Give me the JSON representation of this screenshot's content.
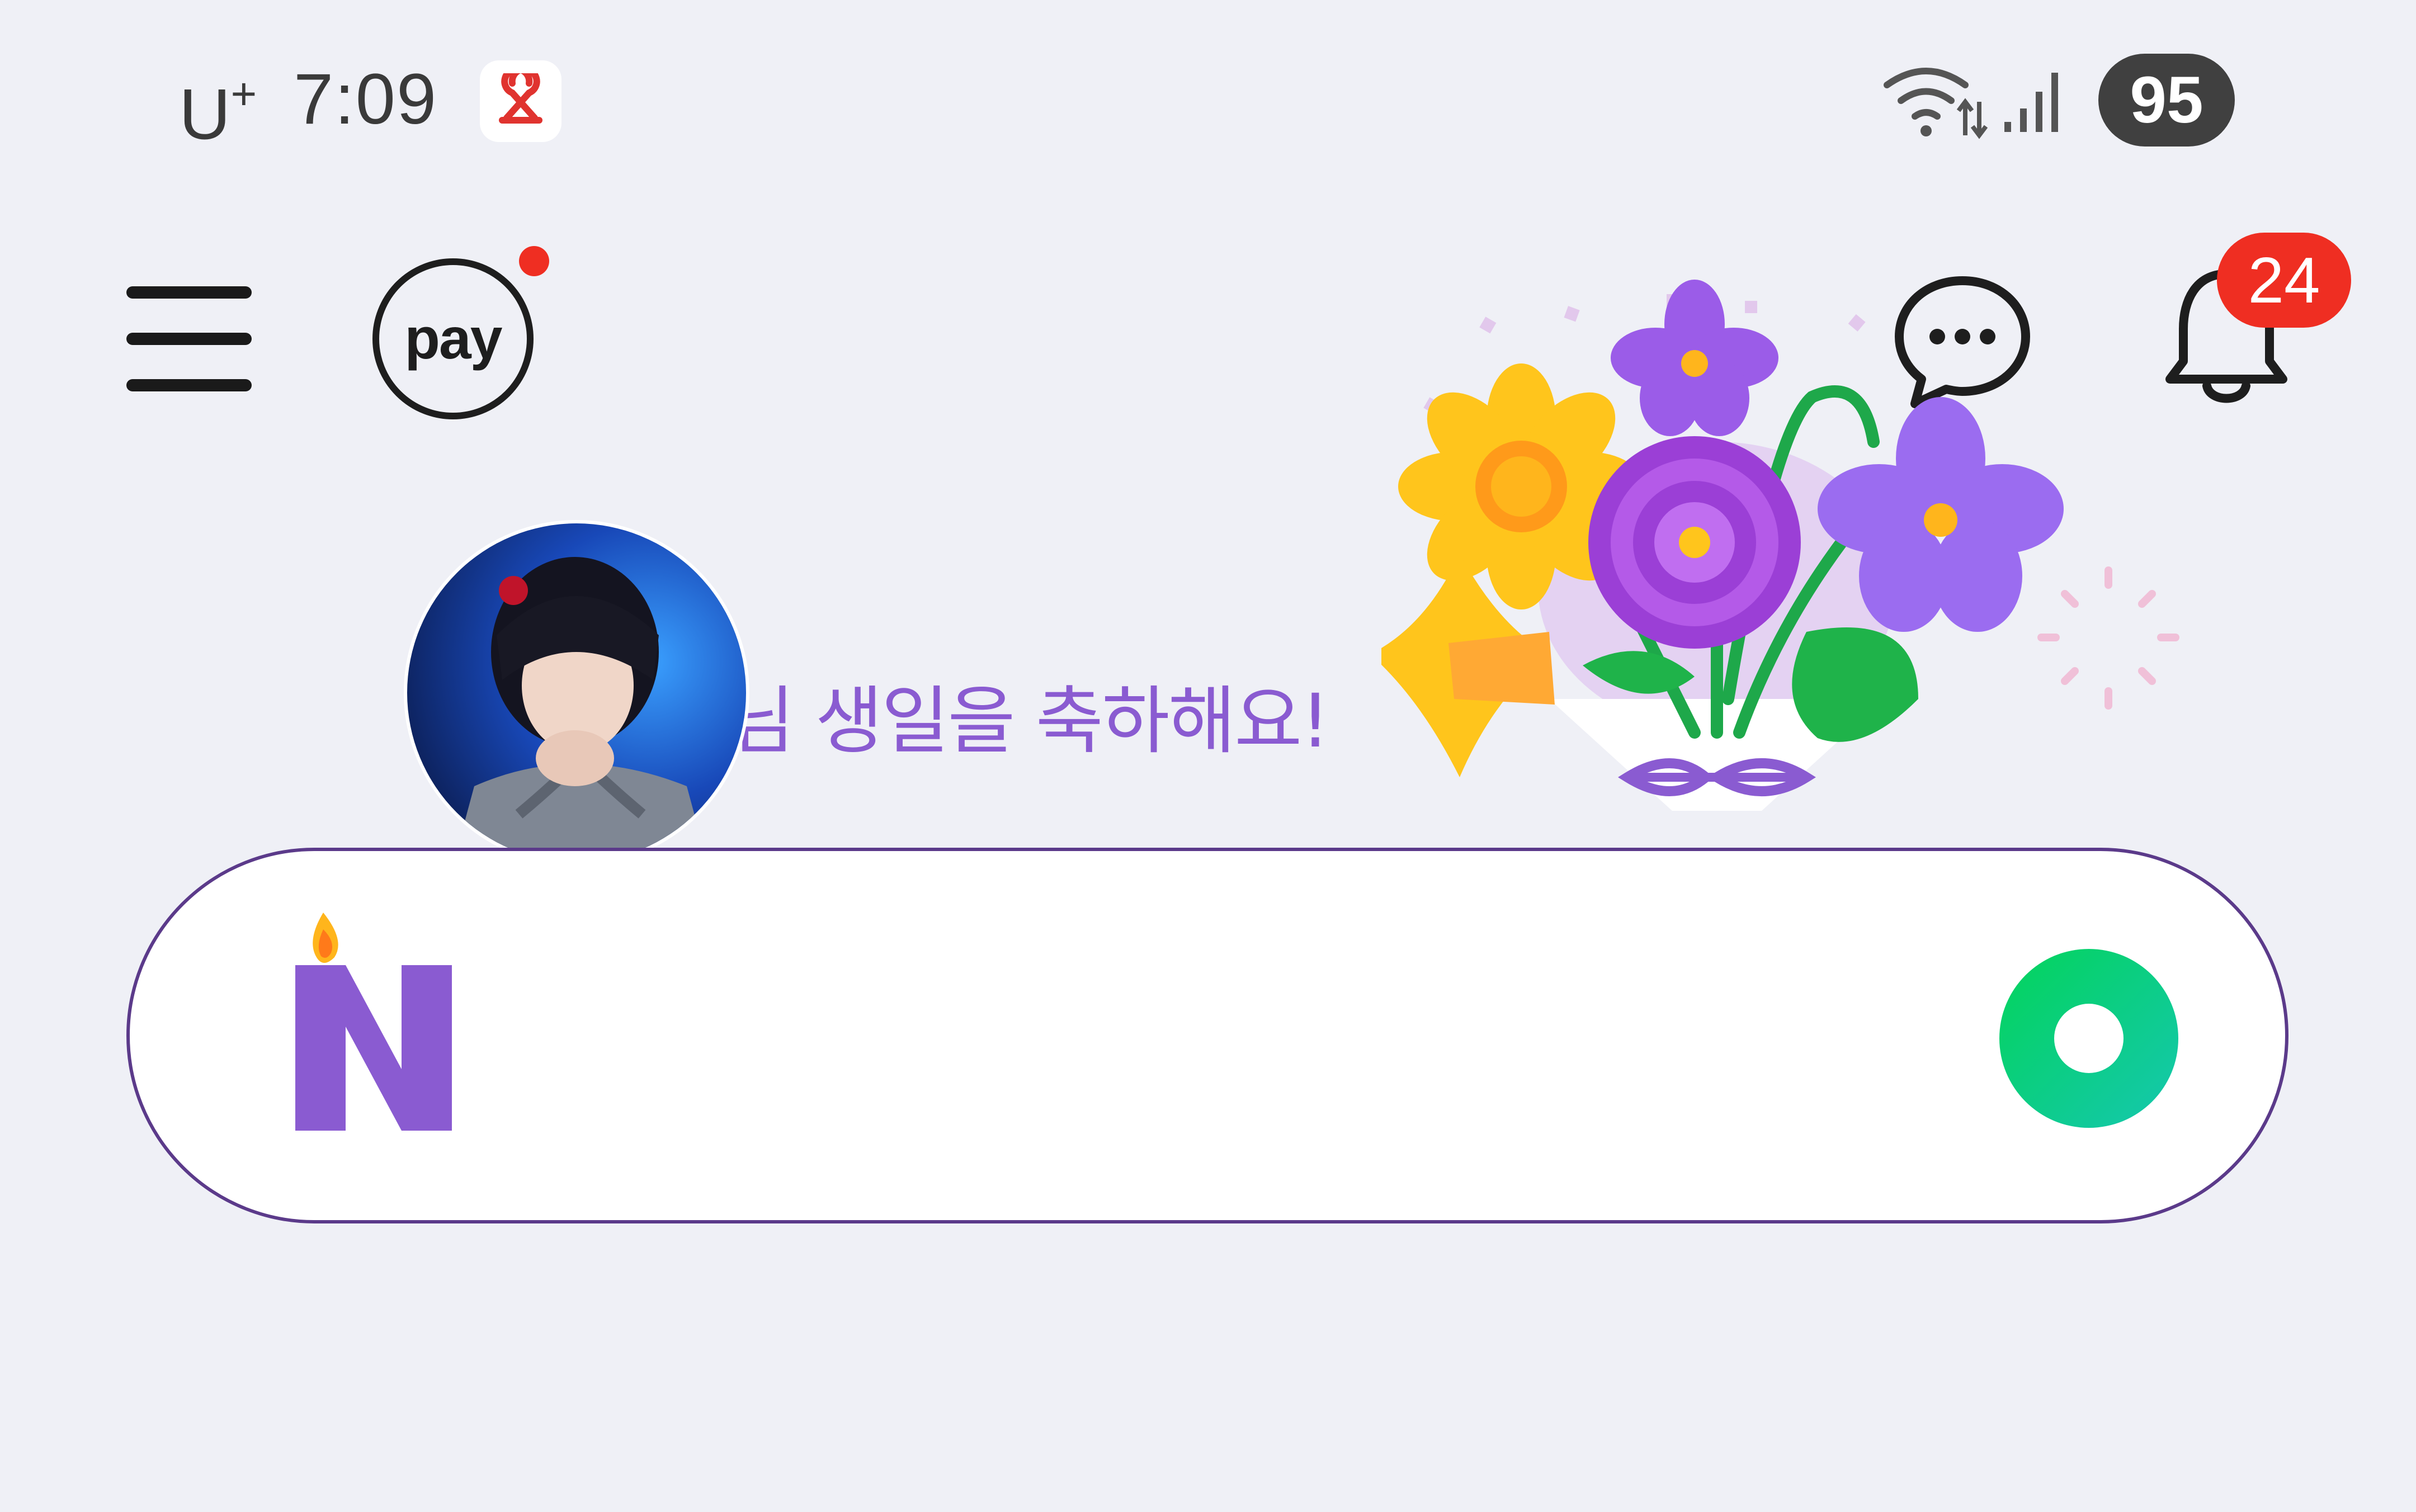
{
  "status_bar": {
    "carrier": "U",
    "carrier_suffix": "+",
    "time": "7:09",
    "battery": "95",
    "icons": [
      "notification-app-icon",
      "wifi-icon",
      "signal-icon",
      "battery-icon"
    ]
  },
  "header": {
    "pay_label": "pay",
    "notification_count": "24",
    "icons": [
      "menu-icon",
      "pay-icon",
      "chat-icon",
      "bell-icon"
    ]
  },
  "greeting": {
    "text": "님 생일을 축하해요!"
  },
  "search": {
    "placeholder": "",
    "value": ""
  },
  "colors": {
    "background": "#eff0f6",
    "accent_purple": "#8a5bd1",
    "badge_red": "#ef2e22",
    "search_border": "#5b3a8a",
    "lens_green": "#03c75a"
  }
}
